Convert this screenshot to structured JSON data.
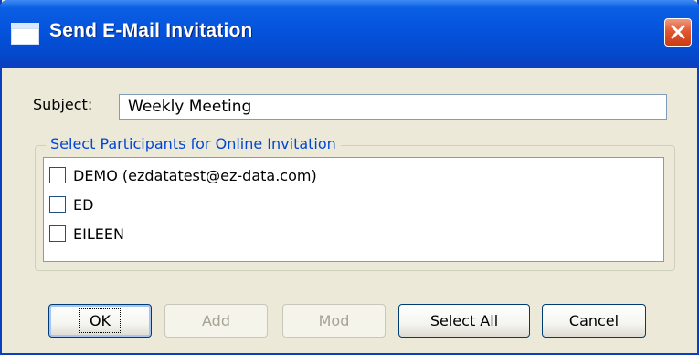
{
  "window": {
    "title": "Send E-Mail Invitation"
  },
  "subject": {
    "label": "Subject:",
    "value": "Weekly Meeting"
  },
  "participants": {
    "group_label": "Select Participants for Online Invitation",
    "items": [
      {
        "label": "DEMO (ezdatatest@ez-data.com)",
        "checked": false
      },
      {
        "label": "ED",
        "checked": false
      },
      {
        "label": "EILEEN",
        "checked": false
      }
    ]
  },
  "buttons": {
    "ok": "OK",
    "add": "Add",
    "mod": "Mod",
    "select_all": "Select All",
    "cancel": "Cancel"
  },
  "icons": {
    "window": "window-icon",
    "close": "close-icon"
  },
  "colors": {
    "titlebar": "#0553dd",
    "dialog_bg": "#ece9d8",
    "group_label": "#0046d5",
    "close_button": "#e2562f"
  }
}
